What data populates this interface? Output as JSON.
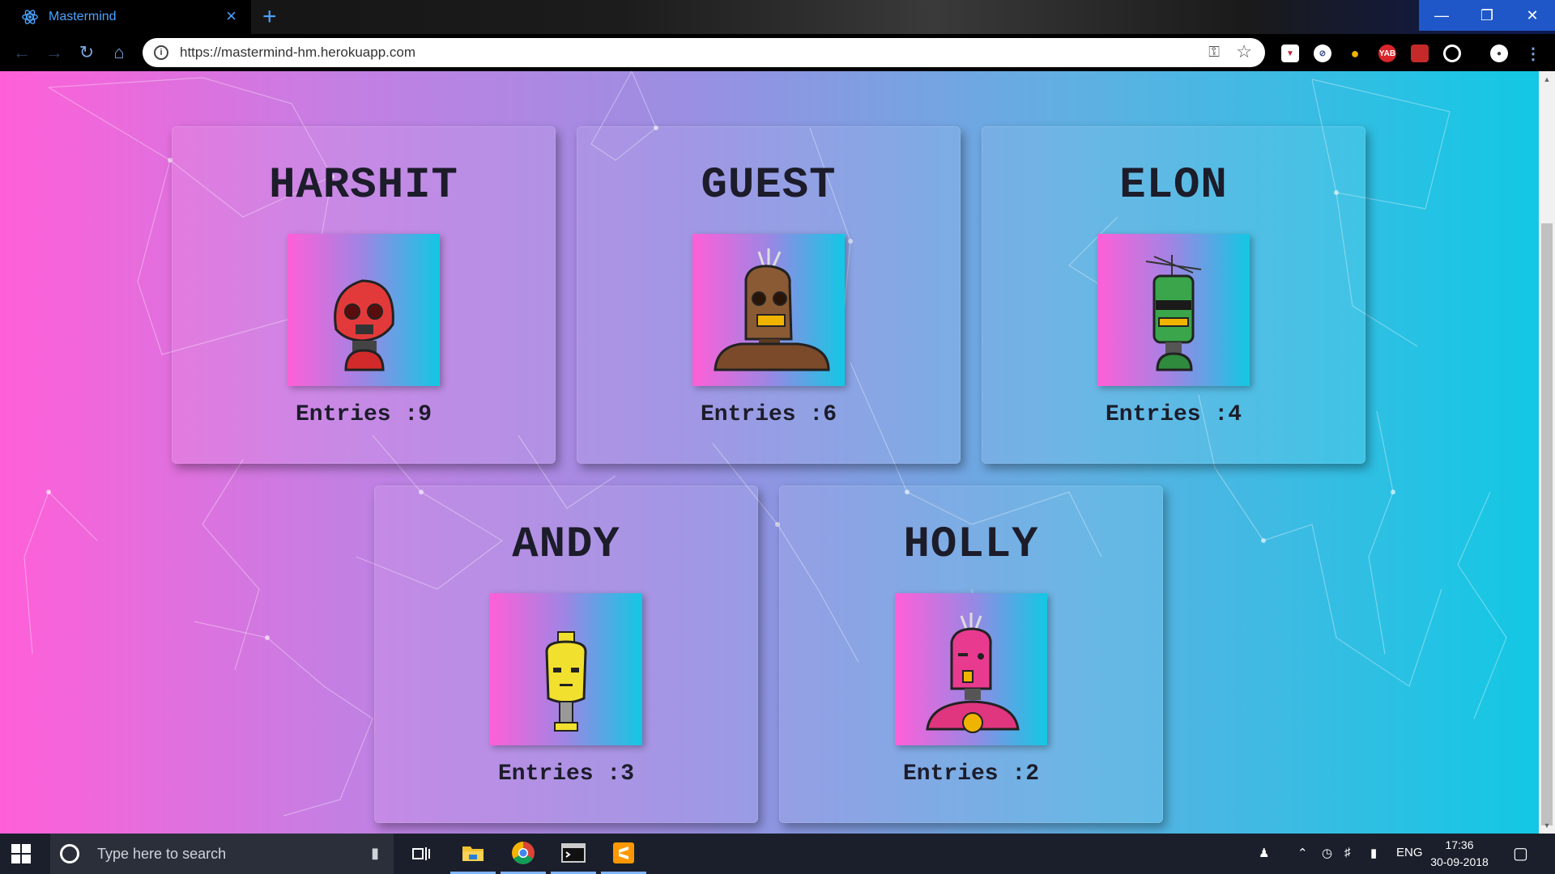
{
  "browser": {
    "tab_title": "Mastermind",
    "url": "https://mastermind-hm.herokuapp.com",
    "new_tab_label": "+",
    "extensions": [
      "pocket-icon",
      "blocker-icon",
      "lightbulb-icon",
      "yab-icon",
      "bookmark-icon",
      "target-icon",
      "profile-icon"
    ],
    "ext_yab_label": "YAB"
  },
  "leaderboard": {
    "players": [
      {
        "name": "HARSHIT",
        "entries": "Entries :9",
        "robot_color": "#e23a3a"
      },
      {
        "name": "GUEST",
        "entries": "Entries :6",
        "robot_color": "#8a5a34"
      },
      {
        "name": "ELON",
        "entries": "Entries :4",
        "robot_color": "#3aa54a"
      },
      {
        "name": "ANDY",
        "entries": "Entries :3",
        "robot_color": "#f2e02e"
      },
      {
        "name": "HOLLY",
        "entries": "Entries :2",
        "robot_color": "#e83a8f"
      }
    ]
  },
  "taskbar": {
    "search_placeholder": "Type here to search",
    "language": "ENG",
    "time": "17:36",
    "date": "30-09-2018"
  },
  "colors": {
    "gradient_left": "#ff5fd8",
    "gradient_right": "#12c8e4",
    "accent_blue": "#1f57c9"
  }
}
